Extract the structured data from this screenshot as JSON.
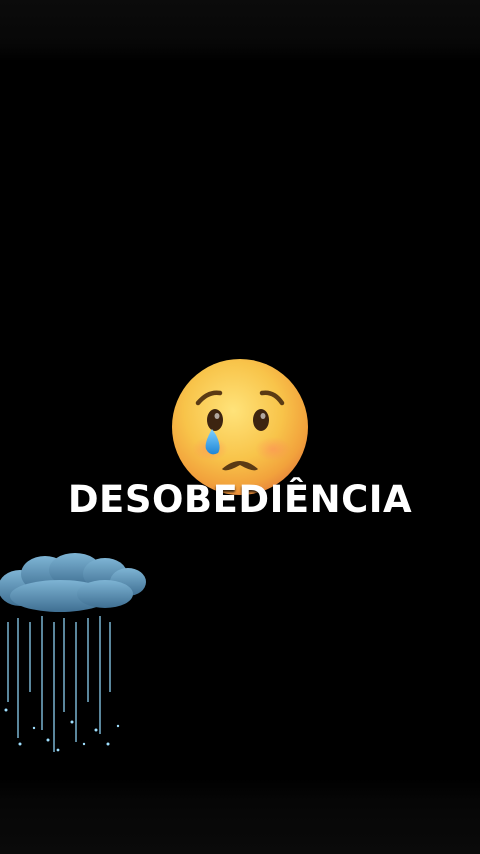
{
  "video_frame": {
    "caption": "DESOBEDIÊNCIA",
    "main_emoji": "crying-face-icon",
    "decoration": "rain-cloud-icon",
    "colors": {
      "background": "#000000",
      "caption": "#ffffff",
      "emoji_face": "#f7c64a",
      "tear": "#3aa6e8",
      "cloud": "#5a93b8",
      "rain": "#8fd3f5"
    }
  }
}
